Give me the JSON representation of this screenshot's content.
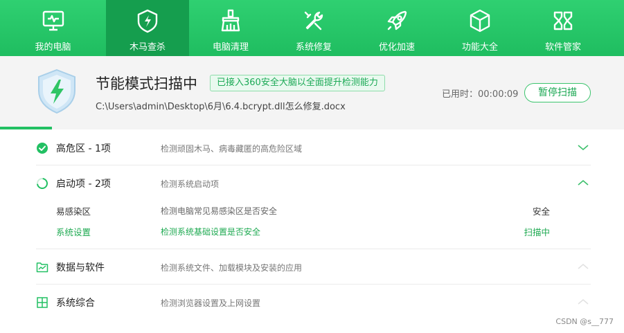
{
  "nav": {
    "items": [
      {
        "label": "我的电脑",
        "icon": "monitor-icon",
        "active": false
      },
      {
        "label": "木马查杀",
        "icon": "shield-bolt-icon",
        "active": true
      },
      {
        "label": "电脑清理",
        "icon": "broom-icon",
        "active": false
      },
      {
        "label": "系统修复",
        "icon": "wrench-icon",
        "active": false
      },
      {
        "label": "优化加速",
        "icon": "rocket-icon",
        "active": false
      },
      {
        "label": "功能大全",
        "icon": "cube-icon",
        "active": false
      },
      {
        "label": "软件管家",
        "icon": "flower-icon",
        "active": false
      }
    ]
  },
  "scan": {
    "title": "节能模式扫描中",
    "badge": "已接入360安全大脑以全面提升检测能力",
    "current_file": "C:\\Users\\admin\\Desktop\\6月\\6.4.bcrypt.dll怎么修复.docx",
    "elapsed_label": "已用时：00:00:09",
    "pause_label": "暂停扫描",
    "progress": 0.083
  },
  "sections": [
    {
      "title": "高危区 -  1项",
      "desc": "检测顽固木马、病毒藏匿的高危险区域",
      "icon": "check-circle-icon",
      "state": "done",
      "expanded": false
    },
    {
      "title": "启动项 -  2项",
      "desc": "检测系统启动项",
      "icon": "loading-spinner-icon",
      "state": "scanning",
      "expanded": true,
      "items": [
        {
          "name": "易感染区",
          "desc": "检测电脑常见易感染区是否安全",
          "status": "安全",
          "scanning": false
        },
        {
          "name": "系统设置",
          "desc": "检测系统基础设置是否安全",
          "status": "扫描中",
          "scanning": true
        }
      ]
    },
    {
      "title": "数据与软件",
      "desc": "检测系统文件、加载模块及安装的应用",
      "icon": "data-chart-icon",
      "state": "pending",
      "expanded": false
    },
    {
      "title": "系统综合",
      "desc": "检测浏览器设置及上网设置",
      "icon": "windows-icon",
      "state": "pending",
      "expanded": false
    }
  ],
  "watermark": "CSDN @s__777",
  "colors": {
    "brand": "#22c063",
    "nav_active": "#159e4e",
    "scanning_text": "#1faa52"
  }
}
